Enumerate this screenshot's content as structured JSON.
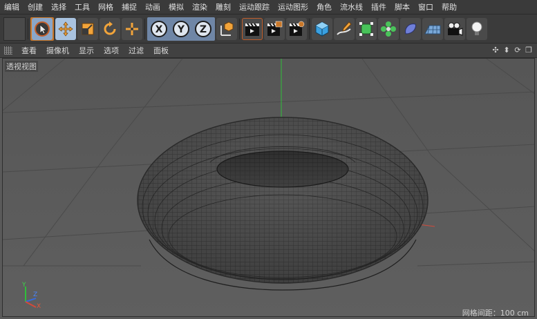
{
  "menu": [
    "编辑",
    "创建",
    "选择",
    "工具",
    "网格",
    "捕捉",
    "动画",
    "模拟",
    "渲染",
    "雕刻",
    "运动跟踪",
    "运动图形",
    "角色",
    "流水线",
    "插件",
    "脚本",
    "窗口",
    "帮助"
  ],
  "toolbar": {
    "tools": [
      {
        "name": "live-selection",
        "icon": "cursor-icon"
      },
      {
        "name": "move",
        "icon": "move-icon"
      },
      {
        "name": "scale",
        "icon": "scale-icon"
      },
      {
        "name": "rotate",
        "icon": "rotate-icon"
      },
      {
        "name": "last-tool",
        "icon": "crosshair-icon"
      }
    ],
    "axes": [
      "X",
      "Y",
      "Z"
    ],
    "accent_colors": {
      "blue_group": "#6f86a6",
      "orange": "#c9782a",
      "x": "#e05a3a",
      "y": "#3fb24a",
      "z": "#3a69d6"
    }
  },
  "viewport_menu": [
    "查看",
    "摄像机",
    "显示",
    "选项",
    "过滤",
    "面板"
  ],
  "viewport": {
    "title": "透视视图",
    "footer": "网格间距：100 cm",
    "axis_labels": {
      "x": "X",
      "y": "Y",
      "z": "Z"
    }
  }
}
